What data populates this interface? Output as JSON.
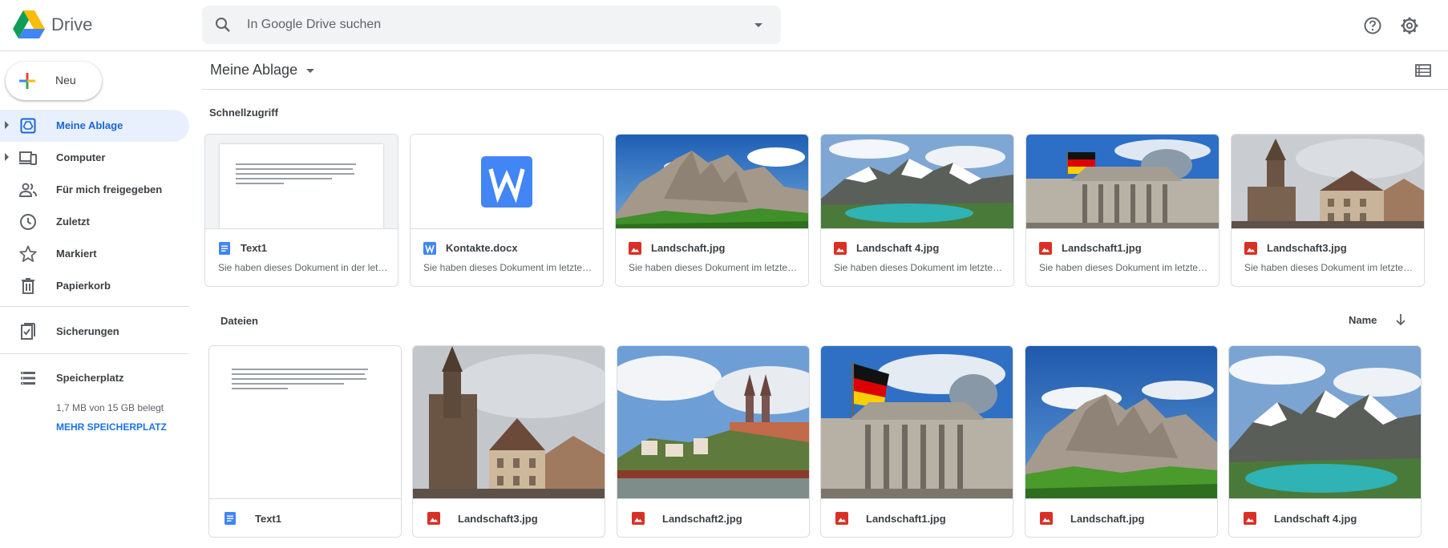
{
  "header": {
    "brand": "Drive",
    "search_placeholder": "In Google Drive suchen"
  },
  "sidebar": {
    "new_label": "Neu",
    "items": [
      {
        "label": "Meine Ablage",
        "icon": "my-drive-icon",
        "active": true
      },
      {
        "label": "Computer",
        "icon": "computer-icon"
      },
      {
        "label": "Für mich freigegeben",
        "icon": "shared-icon"
      },
      {
        "label": "Zuletzt",
        "icon": "clock-icon"
      },
      {
        "label": "Markiert",
        "icon": "star-icon"
      },
      {
        "label": "Papierkorb",
        "icon": "trash-icon"
      },
      {
        "label": "Sicherungen",
        "icon": "backup-icon"
      },
      {
        "label": "Speicherplatz",
        "icon": "storage-icon"
      }
    ],
    "storage_text": "1,7 MB von 15 GB belegt",
    "storage_link": "MEHR SPEICHERPLATZ"
  },
  "main": {
    "title": "Meine Ablage",
    "quick_access_label": "Schnellzugriff",
    "files_label": "Dateien",
    "sort_label": "Name",
    "quick_access": [
      {
        "name": "Text1",
        "desc": "Sie haben dieses Dokument in der letzten Zeit geöffnet",
        "type": "doc"
      },
      {
        "name": "Kontakte.docx",
        "desc": "Sie haben dieses Dokument im letzten Monat geöffnet",
        "type": "word"
      },
      {
        "name": "Landschaft.jpg",
        "desc": "Sie haben dieses Dokument im letzten Monat geöffnet",
        "type": "image"
      },
      {
        "name": "Landschaft 4.jpg",
        "desc": "Sie haben dieses Dokument im letzten Monat geöffnet",
        "type": "image"
      },
      {
        "name": "Landschaft1.jpg",
        "desc": "Sie haben dieses Dokument im letzten Monat geöffnet",
        "type": "image"
      },
      {
        "name": "Landschaft3.jpg",
        "desc": "Sie haben dieses Dokument im letzten Monat geöffnet",
        "type": "image"
      }
    ],
    "files": [
      {
        "name": "Text1",
        "type": "doc"
      },
      {
        "name": "Landschaft3.jpg",
        "type": "image"
      },
      {
        "name": "Landschaft2.jpg",
        "type": "image"
      },
      {
        "name": "Landschaft1.jpg",
        "type": "image"
      },
      {
        "name": "Landschaft.jpg",
        "type": "image"
      },
      {
        "name": "Landschaft 4.jpg",
        "type": "image"
      }
    ]
  },
  "colors": {
    "accent": "#1a73e8",
    "active_bg": "#e8f0fe",
    "doc_blue": "#4285f4",
    "image_red": "#d93025"
  }
}
